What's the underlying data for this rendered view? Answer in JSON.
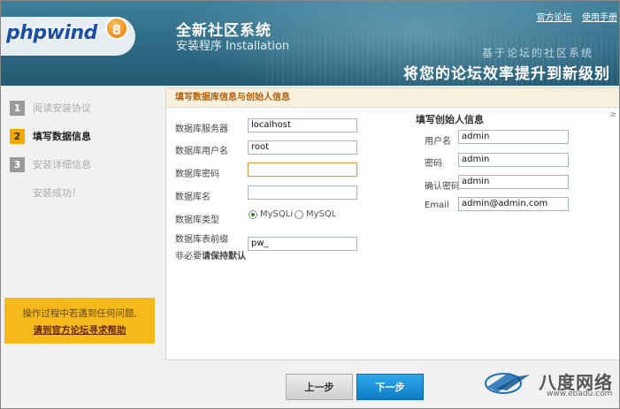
{
  "header": {
    "title": "全新社区系统",
    "subtitle": "安装程序 Installation",
    "logo_text": "phpwind",
    "logo_version": "8",
    "links": [
      "官方论坛",
      "使用手册"
    ],
    "slogan_line1": "基于论坛的社区系统",
    "slogan_line2": "将您的论坛效率提升到新级别"
  },
  "sidebar": {
    "steps": [
      {
        "number": "1",
        "label": "阅读安装协议",
        "state": "done"
      },
      {
        "number": "2",
        "label": "填写数据信息",
        "state": "active"
      },
      {
        "number": "3",
        "label": "安装详细信息",
        "state": "todo"
      },
      {
        "number": "",
        "label": "安装成功！",
        "state": "todo"
      }
    ],
    "help_line1": "操作过程中若遇到任何问题,",
    "help_line2": "请到官方论坛寻求帮助"
  },
  "panel": {
    "header": "填写数据库信息与创始人信息",
    "db": {
      "server_label": "数据库服务器",
      "server_value": "localhost",
      "user_label": "数据库用户名",
      "user_value": "root",
      "password_label": "数据库密码",
      "password_value": "",
      "name_label": "数据库名",
      "name_value": "",
      "type_label": "数据库类型",
      "type_options": [
        "MySQLi",
        "MySQL"
      ],
      "type_selected": "MySQLi",
      "prefix_label": "数据库表前缀",
      "prefix_hint_prefix": "非必要",
      "prefix_hint_bold": "请保持默认",
      "prefix_value": "pw_"
    },
    "founder": {
      "title": "填写创始人信息",
      "username_label": "用户名",
      "username_value": "admin",
      "password_label": "密码",
      "password_value": "admin",
      "confirm_label": "确认密码",
      "confirm_value": "admin",
      "email_label": "Email",
      "email_value": "admin@admin.com"
    }
  },
  "buttons": {
    "prev": "上一步",
    "next": "下一步"
  },
  "watermark": {
    "name": "八度网络",
    "url": "www.ebadu.com"
  },
  "colors": {
    "header_blue": "#2f6c87",
    "active_step": "#f2a900",
    "help_box": "#f6b91c",
    "next_button": "#0d7cc6",
    "panel_header_text": "#b3600c"
  }
}
